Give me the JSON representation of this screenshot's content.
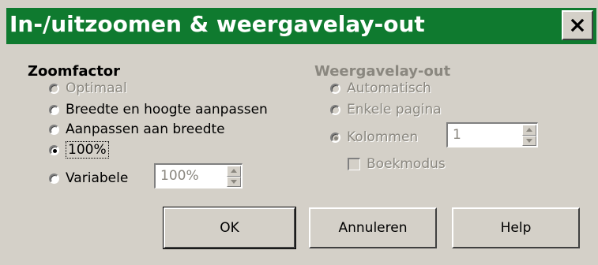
{
  "window": {
    "title": "In-/uitzoomen & weergavelay-out",
    "close_label": "Close"
  },
  "zoom": {
    "group_label": "Zoomfactor",
    "options": [
      {
        "label": "Optimaal",
        "selected": false,
        "enabled": false
      },
      {
        "label": "Breedte en hoogte aanpassen",
        "selected": false,
        "enabled": true
      },
      {
        "label": "Aanpassen aan breedte",
        "selected": false,
        "enabled": true
      },
      {
        "label": "100%",
        "selected": true,
        "enabled": true
      },
      {
        "label": "Variabele",
        "selected": false,
        "enabled": true
      }
    ],
    "variable_value": "100%"
  },
  "layout": {
    "group_label": "Weergavelay-out",
    "options": [
      {
        "label": "Automatisch",
        "selected": false,
        "enabled": false
      },
      {
        "label": "Enkele pagina",
        "selected": false,
        "enabled": false
      },
      {
        "label": "Kolommen",
        "selected": true,
        "enabled": false
      }
    ],
    "columns_value": "1",
    "book_mode_label": "Boekmodus",
    "book_mode_checked": false
  },
  "buttons": {
    "ok": "OK",
    "cancel": "Annuleren",
    "help": "Help"
  },
  "colors": {
    "title_bar": "#0f7a2f",
    "dialog_bg": "#d4d0c8",
    "disabled_text": "#8a877f"
  }
}
